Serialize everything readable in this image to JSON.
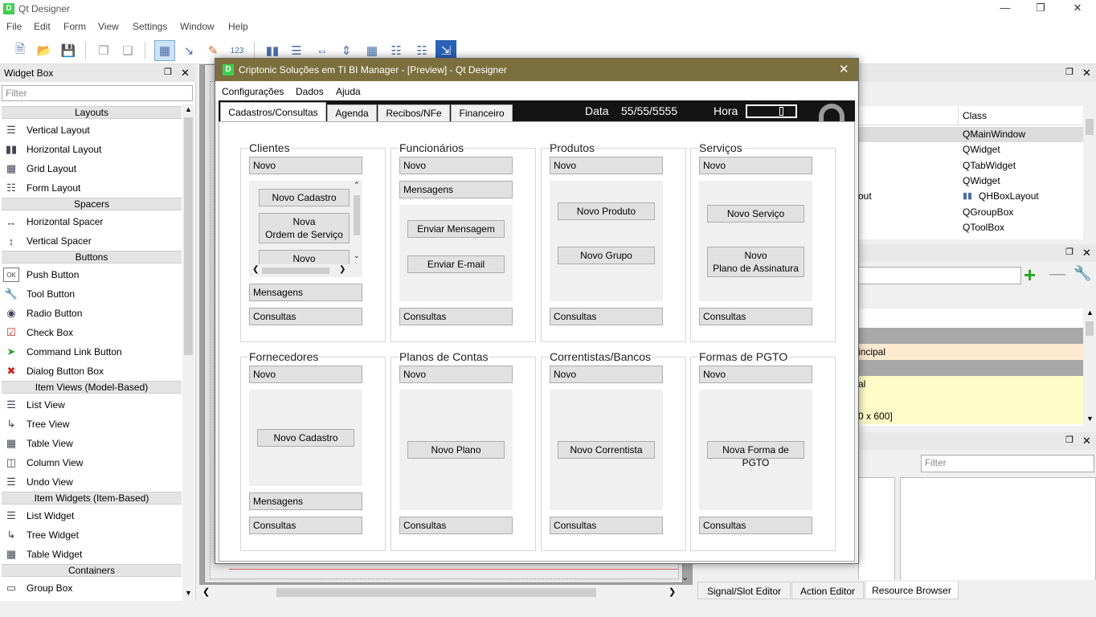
{
  "app": {
    "title": "Qt Designer",
    "icon": "qt-designer-icon"
  },
  "menu": [
    "File",
    "Edit",
    "Form",
    "View",
    "Settings",
    "Window",
    "Help"
  ],
  "toolbar_icons": [
    "new-form-icon",
    "open-form-icon",
    "save-form-icon",
    "send-to-back-icon",
    "bring-to-front-icon",
    "edit-widgets-icon",
    "edit-signals-slots-icon",
    "edit-buddies-icon",
    "edit-tab-order-icon",
    "lay-out-horizontally-icon",
    "lay-out-vertically-icon",
    "lay-out-horizontal-splitter-icon",
    "lay-out-vertical-splitter-icon",
    "lay-out-grid-icon",
    "lay-out-form-icon",
    "break-layout-icon",
    "adjust-size-icon"
  ],
  "widget_box": {
    "title": "Widget Box",
    "filter_placeholder": "Filter",
    "categories": [
      {
        "label": "Layouts",
        "items": [
          "Vertical Layout",
          "Horizontal Layout",
          "Grid Layout",
          "Form Layout"
        ]
      },
      {
        "label": "Spacers",
        "items": [
          "Horizontal Spacer",
          "Vertical Spacer"
        ]
      },
      {
        "label": "Buttons",
        "items": [
          "Push Button",
          "Tool Button",
          "Radio Button",
          "Check Box",
          "Command Link Button",
          "Dialog Button Box"
        ]
      },
      {
        "label": "Item Views (Model-Based)",
        "items": [
          "List View",
          "Tree View",
          "Table View",
          "Column View",
          "Undo View"
        ]
      },
      {
        "label": "Item Widgets (Item-Based)",
        "items": [
          "List Widget",
          "Tree Widget",
          "Table Widget"
        ]
      },
      {
        "label": "Containers",
        "items": [
          "Group Box"
        ]
      }
    ]
  },
  "object_inspector": {
    "column_class": "Class",
    "rows": [
      {
        "object": "",
        "class": "QMainWindow"
      },
      {
        "object": "",
        "class": "QWidget"
      },
      {
        "object": "",
        "class": "QTabWidget"
      },
      {
        "object": "",
        "class": "QWidget"
      },
      {
        "object": "out",
        "class": "QHBoxLayout"
      },
      {
        "object": "",
        "class": "QGroupBox"
      },
      {
        "object": "",
        "class": "QToolBox"
      }
    ]
  },
  "property_editor": {
    "rows": [
      {
        "text": "",
        "style": "header"
      },
      {
        "text": "incipal",
        "style": "orange"
      },
      {
        "text": "",
        "style": "header"
      },
      {
        "text": "al",
        "style": "yellow"
      },
      {
        "text": "",
        "style": "yellow"
      },
      {
        "text": "0 x 600]",
        "style": "yellow"
      }
    ]
  },
  "resource_browser": {
    "filter_placeholder": "Filter"
  },
  "bottom_tabs": [
    "Signal/Slot Editor",
    "Action Editor",
    "Resource Browser"
  ],
  "preview": {
    "title": "Criptonic Soluções em TI BI Manager - [Preview] - Qt Designer",
    "menu": [
      "Configurações",
      "Dados",
      "Ajuda"
    ],
    "tabs": [
      "Cadastros/Consultas",
      "Agenda",
      "Recibos/NFe",
      "Financeiro"
    ],
    "date_label": "Data",
    "date_value": "55/55/5555",
    "hour_label": "Hora",
    "groups": [
      {
        "title": "Clientes",
        "top": "Novo",
        "inner": [
          "Novo Cadastro",
          "Nova\nOrdem de Serviço",
          "Novo"
        ],
        "mid": "Mensagens",
        "bottom": "Consultas"
      },
      {
        "title": "Funcionários",
        "top": "Novo",
        "mid_top": "Mensagens",
        "inner": [
          "Enviar Mensagem",
          "Enviar E-mail"
        ],
        "bottom": "Consultas"
      },
      {
        "title": "Produtos",
        "top": "Novo",
        "inner": [
          "Novo Produto",
          "Novo Grupo"
        ],
        "bottom": "Consultas"
      },
      {
        "title": "Serviços",
        "top": "Novo",
        "inner": [
          "Novo Serviço",
          "Novo\nPlano de Assinatura"
        ],
        "bottom": "Consultas"
      },
      {
        "title": "Fornecedores",
        "top": "Novo",
        "inner": [
          "Novo Cadastro"
        ],
        "mid": "Mensagens",
        "bottom": "Consultas"
      },
      {
        "title": "Planos de Contas",
        "top": "Novo",
        "inner": [
          "Novo Plano"
        ],
        "bottom": "Consultas"
      },
      {
        "title": "Correntistas/Bancos",
        "top": "Novo",
        "inner": [
          "Novo Correntista"
        ],
        "bottom": "Consultas"
      },
      {
        "title": "Formas de PGTO",
        "top": "Novo",
        "inner": [
          "Nova Forma de PGTO"
        ],
        "bottom": "Consultas"
      }
    ]
  }
}
